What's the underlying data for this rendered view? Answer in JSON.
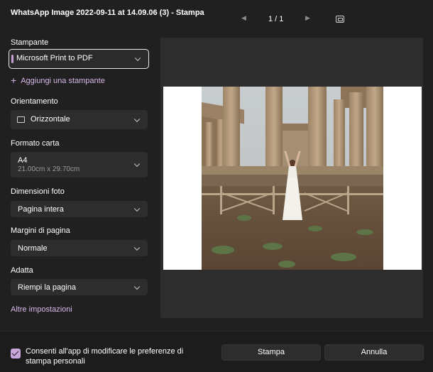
{
  "window": {
    "title": "WhatsApp Image 2022-09-11 at 14.09.06 (3) - Stampa"
  },
  "pager": {
    "prev_icon": "chevron-left-icon",
    "count": "1 / 1",
    "next_icon": "chevron-right-icon",
    "fit_icon": "fit-page-icon"
  },
  "printer": {
    "label": "Stampante",
    "value": "Microsoft Print to PDF",
    "add_label": "Aggiungi una stampante"
  },
  "orientation": {
    "label": "Orientamento",
    "value": "Orizzontale",
    "icon": "page-landscape-icon"
  },
  "paper": {
    "label": "Formato carta",
    "value": "A4",
    "size": "21.00cm x 29.70cm"
  },
  "photo_size": {
    "label": "Dimensioni foto",
    "value": "Pagina intera"
  },
  "margins": {
    "label": "Margini di pagina",
    "value": "Normale"
  },
  "fit": {
    "label": "Adatta",
    "value": "Riempi la pagina"
  },
  "more_settings": "Altre impostazioni",
  "footer": {
    "consent": "Consenti all'app di modificare le preferenze di stampa personali",
    "consent_checked": true,
    "print_label": "Stampa",
    "cancel_label": "Annulla"
  },
  "colors": {
    "accent": "#c9a6dc",
    "background": "#202020",
    "control": "#2d2d2d"
  }
}
